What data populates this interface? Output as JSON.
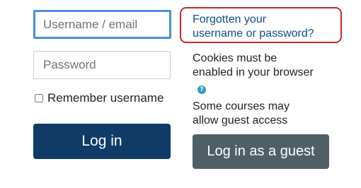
{
  "login_form": {
    "username_placeholder": "Username / email",
    "password_placeholder": "Password",
    "remember_label": "Remember username",
    "login_button_label": "Log in"
  },
  "side_panel": {
    "forgot_link_line1": "Forgotten your",
    "forgot_link_line2": "username or password?",
    "cookies_line1": "Cookies must be",
    "cookies_line2": "enabled in your browser",
    "help_icon": "question-mark-circle-icon",
    "guest_line1": "Some courses may",
    "guest_line2": "allow guest access",
    "guest_button_label": "Log in as a guest"
  },
  "colors": {
    "primary_button": "#0f3b66",
    "secondary_button": "#4f5f65",
    "link": "#0f4d8a",
    "focus_ring": "#4a90d9",
    "highlight_outline": "#c62828",
    "help_icon": "#2f9fbf"
  }
}
